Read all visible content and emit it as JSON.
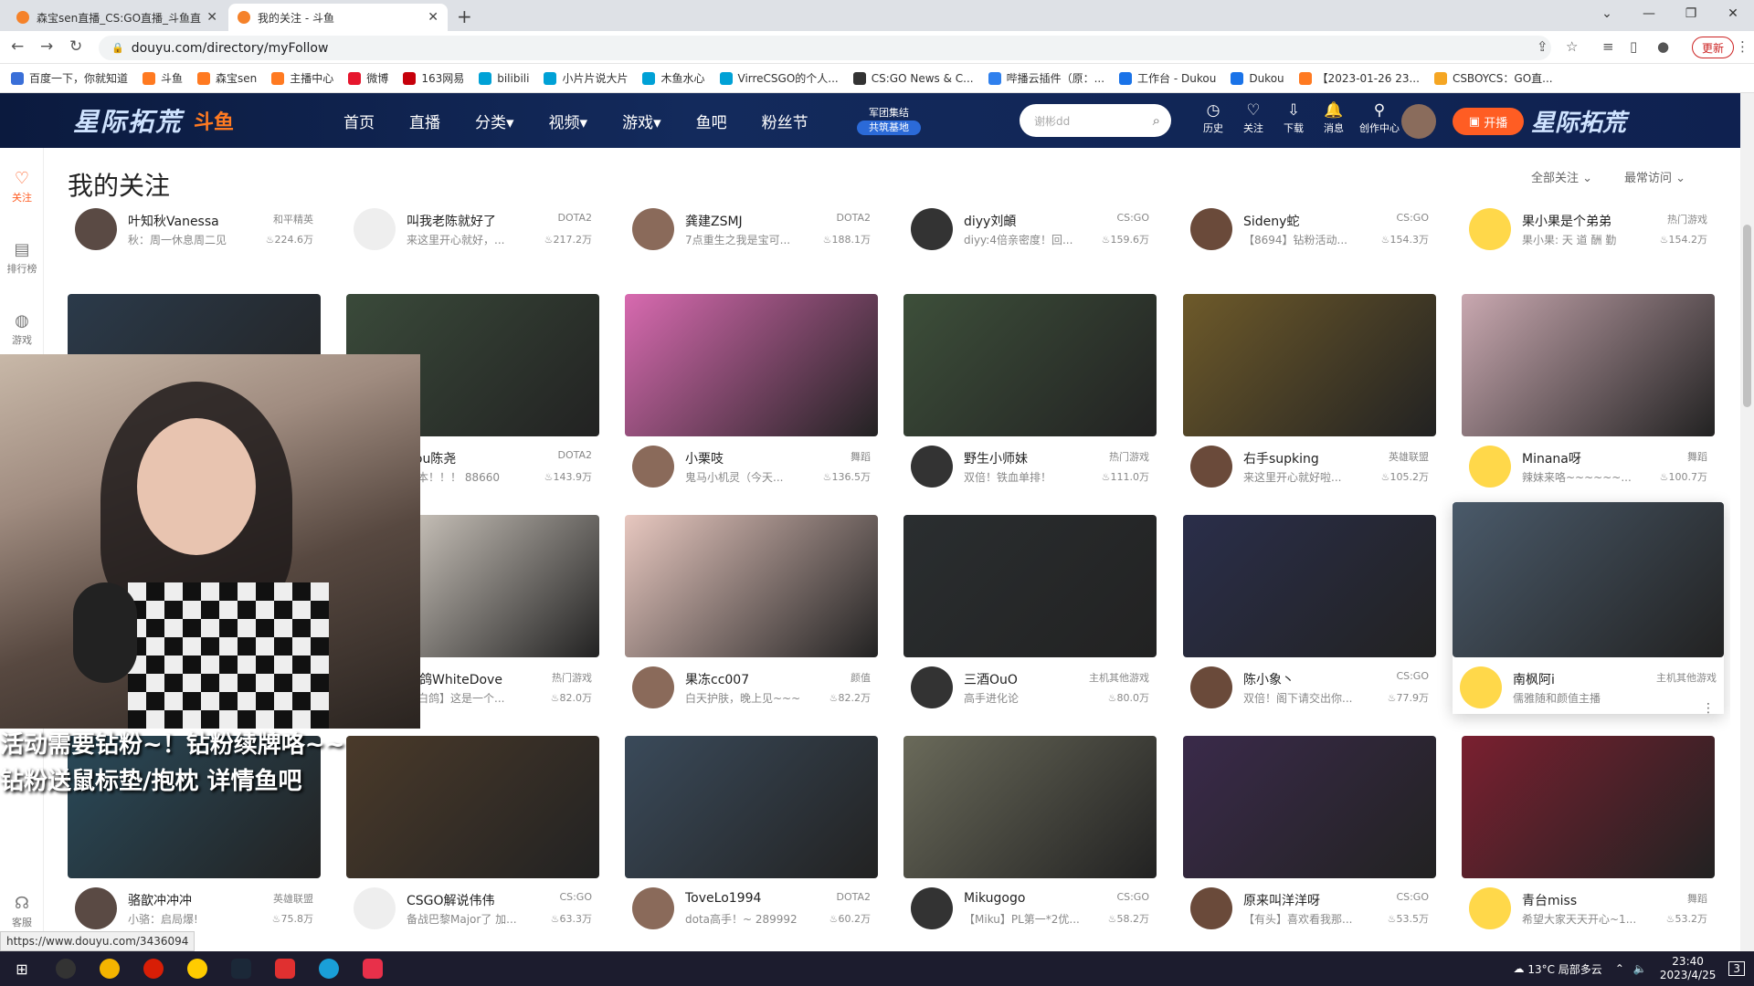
{
  "browser": {
    "tabs": [
      {
        "title": "森宝sen直播_CS:GO直播_斗鱼直播",
        "active": false
      },
      {
        "title": "我的关注 - 斗鱼",
        "active": true
      }
    ],
    "url": "douyu.com/directory/myFollow",
    "update_label": "更新",
    "bookmarks": [
      {
        "label": "百度一下，你就知道",
        "color": "#3a6fd8"
      },
      {
        "label": "斗鱼",
        "color": "#ff7a21"
      },
      {
        "label": "森宝sen",
        "color": "#ff7a21"
      },
      {
        "label": "主播中心",
        "color": "#ff7a21"
      },
      {
        "label": "微博",
        "color": "#e6162d"
      },
      {
        "label": "163网易",
        "color": "#c6000b"
      },
      {
        "label": "bilibili",
        "color": "#00a1d6"
      },
      {
        "label": "小片片说大片",
        "color": "#00a1d6"
      },
      {
        "label": "木鱼水心",
        "color": "#00a1d6"
      },
      {
        "label": "VirreCSGO的个人...",
        "color": "#00a1d6"
      },
      {
        "label": "CS:GO News & C...",
        "color": "#333333"
      },
      {
        "label": "哔播云插件（原：...",
        "color": "#2f80ed"
      },
      {
        "label": "工作台 - Dukou",
        "color": "#1a73e8"
      },
      {
        "label": "Dukou",
        "color": "#1a73e8"
      },
      {
        "label": "【2023-01-26 23...",
        "color": "#ff7a21"
      },
      {
        "label": "CSBOYCS：GO直...",
        "color": "#f5a623"
      }
    ]
  },
  "header": {
    "logo_text": "星际拓荒",
    "brand": "斗鱼",
    "nav": [
      "首页",
      "直播",
      "分类▾",
      "视频▾",
      "游戏▾",
      "鱼吧",
      "粉丝节"
    ],
    "army_badge": [
      "军团集结",
      "共筑基地"
    ],
    "search_placeholder": "谢彬dd",
    "icons": [
      {
        "name": "history",
        "label": "历史",
        "glyph": "◷"
      },
      {
        "name": "follow",
        "label": "关注",
        "glyph": "♡"
      },
      {
        "name": "download",
        "label": "下载",
        "glyph": "⇩"
      },
      {
        "name": "message",
        "label": "消息",
        "glyph": "🔔"
      },
      {
        "name": "creator",
        "label": "创作中心",
        "glyph": "⚲"
      }
    ],
    "live_button": "开播",
    "logo_right": "星际拓荒"
  },
  "sidebar": [
    {
      "label": "关注",
      "glyph": "♡",
      "active": true
    },
    {
      "label": "排行榜",
      "glyph": "▤",
      "active": false
    },
    {
      "label": "游戏",
      "glyph": "◍",
      "active": false
    },
    {
      "label": "客服",
      "glyph": "☊",
      "active": false
    }
  ],
  "page": {
    "title": "我的关注",
    "filter_all": "全部关注",
    "filter_recent": "最常访问"
  },
  "streamers": [
    {
      "name": "叶知秋Vanessa",
      "cat": "和平精英",
      "desc": "秋：周一休息周二见",
      "heat": "224.6万",
      "thumb": false
    },
    {
      "name": "叫我老陈就好了",
      "cat": "DOTA2",
      "desc": "来这里开心就好，...",
      "heat": "217.2万",
      "thumb": false
    },
    {
      "name": "龚建ZSMJ",
      "cat": "DOTA2",
      "desc": "7点重生之我是宝可...",
      "heat": "188.1万",
      "thumb": false
    },
    {
      "name": "diyy刘頔",
      "cat": "CS:GO",
      "desc": "diyy:4倍亲密度！回...",
      "heat": "159.6万",
      "thumb": false
    },
    {
      "name": "Sideny蛇",
      "cat": "CS:GO",
      "desc": "【8694】钻粉活动...",
      "heat": "154.3万",
      "thumb": false
    },
    {
      "name": "果小果是个弟弟",
      "cat": "热门游戏",
      "desc": "果小果: 天 道 酬 勤",
      "heat": "154.2万",
      "thumb": false
    },
    {
      "name": "",
      "cat": "",
      "desc": "",
      "heat": "",
      "thumb": true
    },
    {
      "name": "hou陈尧",
      "cat": "DOTA2",
      "desc": "版本！！！ 88660",
      "heat": "143.9万",
      "thumb": true
    },
    {
      "name": "小栗吱",
      "cat": "舞蹈",
      "desc": "鬼马小机灵（今天...",
      "heat": "136.5万",
      "thumb": true
    },
    {
      "name": "野生小师妹",
      "cat": "热门游戏",
      "desc": "双倍！铁血单排！",
      "heat": "111.0万",
      "thumb": true
    },
    {
      "name": "右手supking",
      "cat": "英雄联盟",
      "desc": "来这里开心就好啦...",
      "heat": "105.2万",
      "thumb": true
    },
    {
      "name": "Minana呀",
      "cat": "舞蹈",
      "desc": "辣妹来咯~~~~~~...",
      "heat": "100.7万",
      "thumb": true
    },
    {
      "name": "",
      "cat": "",
      "desc": "",
      "heat": "",
      "thumb": true
    },
    {
      "name": "白鸽WhiteDove",
      "cat": "热门游戏",
      "desc": "小白鸽】这是一个...",
      "heat": "82.0万",
      "thumb": true
    },
    {
      "name": "果冻cc007",
      "cat": "颜值",
      "desc": "白天护肤，晚上见~~~",
      "heat": "82.2万",
      "thumb": true
    },
    {
      "name": "三酒OuO",
      "cat": "主机其他游戏",
      "desc": "高手进化论",
      "heat": "80.0万",
      "thumb": true
    },
    {
      "name": "陈小象丶",
      "cat": "CS:GO",
      "desc": "双倍！阁下请交出你...",
      "heat": "77.9万",
      "thumb": true
    },
    {
      "name": "南枫阿i",
      "cat": "主机其他游戏",
      "desc": "儒雅随和颜值主播",
      "heat": "",
      "thumb": true,
      "hover": true
    },
    {
      "name": "骆歆冲冲冲",
      "cat": "英雄联盟",
      "desc": "小骆：启局爆!",
      "heat": "75.8万",
      "thumb": true
    },
    {
      "name": "CSGO解说伟伟",
      "cat": "CS:GO",
      "desc": "备战巴黎Major了 加...",
      "heat": "63.3万",
      "thumb": true
    },
    {
      "name": "ToveLo1994",
      "cat": "DOTA2",
      "desc": "dota高手！~ 289992",
      "heat": "60.2万",
      "thumb": true
    },
    {
      "name": "Mikugogo",
      "cat": "CS:GO",
      "desc": "【Miku】PL第一*2优...",
      "heat": "58.2万",
      "thumb": true
    },
    {
      "name": "原来叫洋洋呀",
      "cat": "CS:GO",
      "desc": "【有头】喜欢看我那...",
      "heat": "53.5万",
      "thumb": true
    },
    {
      "name": "青台miss",
      "cat": "舞蹈",
      "desc": "希望大家天天开心~1...",
      "heat": "53.2万",
      "thumb": true
    }
  ],
  "thumb_colors": [
    "#2b3a4a",
    "#3a4a3a",
    "#d86ab0",
    "#3d4f3a",
    "#6e5a2a",
    "#c9a8b0",
    "#4a4a5a",
    "#e8e0d6",
    "#e8c8c0",
    "#2a2e30",
    "#2a2e4a",
    "#4a5a6a",
    "#2a4a5a",
    "#4a3a2a",
    "#3a4a5a",
    "#6a6a5a",
    "#3a2a4a",
    "#7a2030"
  ],
  "pip": {
    "overlay_line1": "活动需要钻粉~！钻粉续牌咯~~",
    "overlay_line2": "钻粉送鼠标垫/抱枕 详情鱼吧"
  },
  "status_url": "https://www.douyu.com/3436094",
  "taskbar": {
    "weather": "13°C 局部多云",
    "time": "23:40",
    "date": "2023/4/25",
    "notif_count": "3"
  }
}
